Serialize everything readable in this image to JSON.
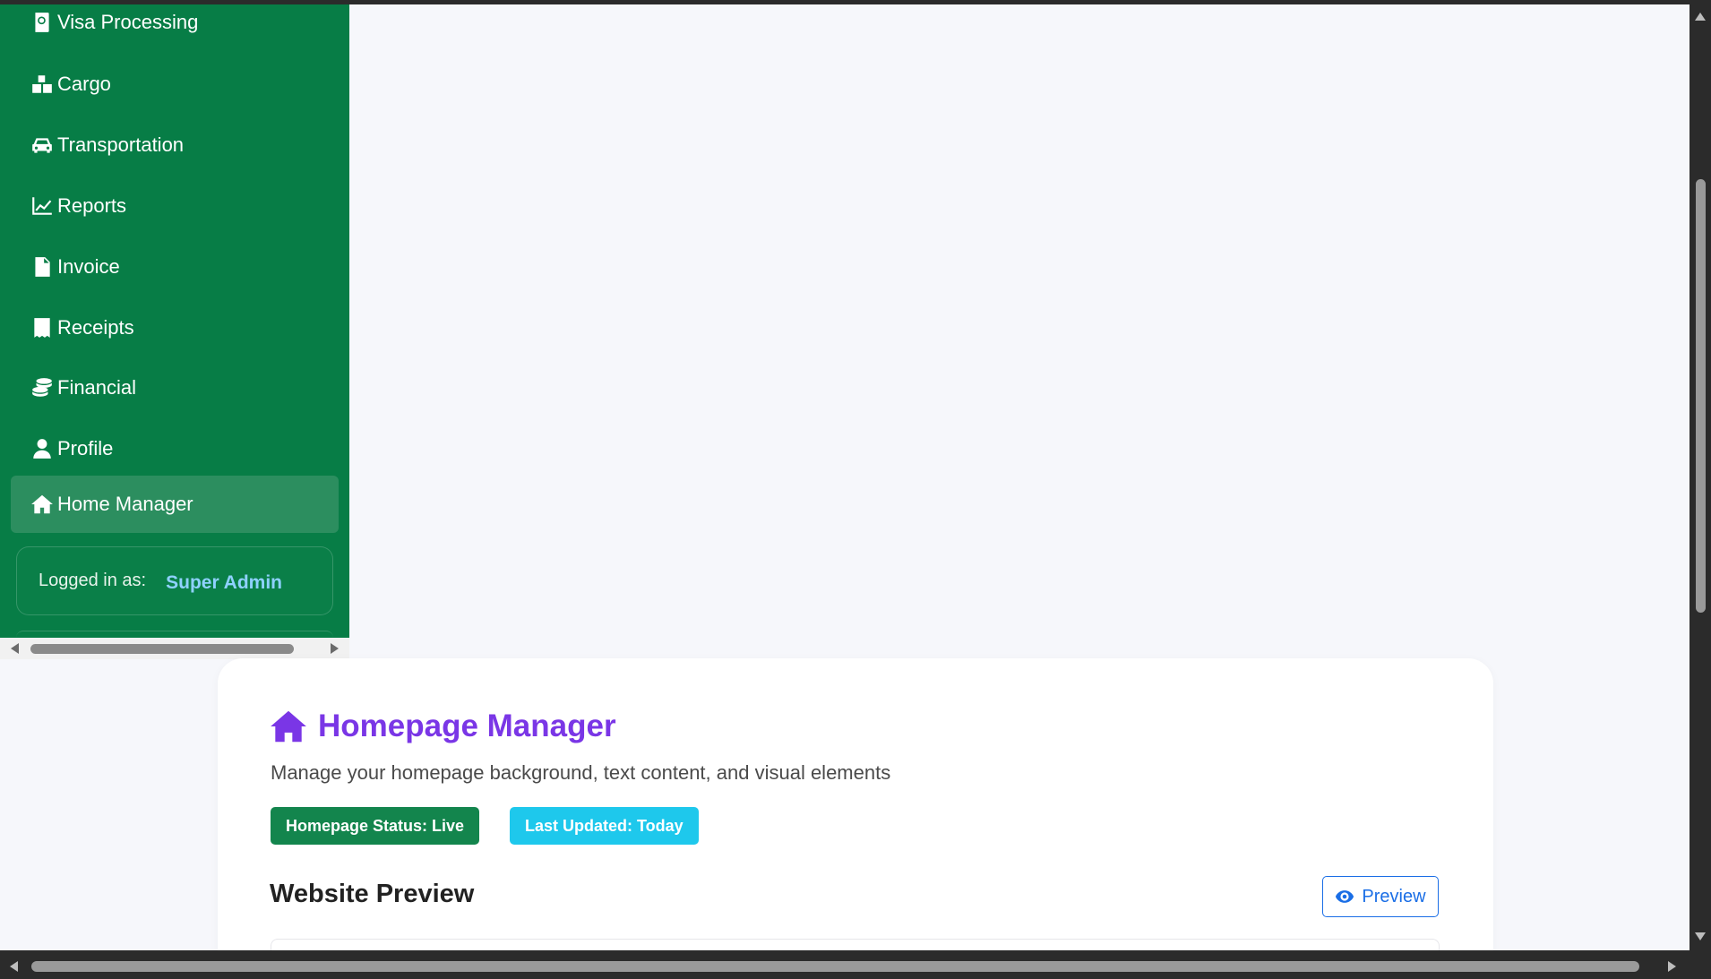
{
  "sidebar": {
    "items": [
      {
        "label": "Visa Processing",
        "icon": "passport-icon"
      },
      {
        "label": "Cargo",
        "icon": "boxes-icon"
      },
      {
        "label": "Transportation",
        "icon": "car-icon"
      },
      {
        "label": "Reports",
        "icon": "chart-line-icon"
      },
      {
        "label": "Invoice",
        "icon": "file-invoice-icon"
      },
      {
        "label": "Receipts",
        "icon": "receipt-icon"
      },
      {
        "label": "Financial",
        "icon": "coins-icon"
      },
      {
        "label": "Profile",
        "icon": "user-icon"
      },
      {
        "label": "Home Manager",
        "icon": "home-icon",
        "active": true
      }
    ],
    "logged_in_label": "Logged in as:",
    "logged_in_user": "Super Admin"
  },
  "main": {
    "title": "Homepage Manager",
    "subtitle": "Manage your homepage background, text content, and visual elements",
    "badges": {
      "status": "Homepage Status: Live",
      "updated": "Last Updated: Today"
    },
    "section_title": "Website Preview",
    "preview_button": "Preview"
  },
  "colors": {
    "sidebar_bg": "#077d46",
    "active_item_bg": "#2c8e5f",
    "title_purple": "#7a36e6",
    "status_badge": "#13854d",
    "updated_badge": "#1ec8ec",
    "preview_blue": "#1a6ee6",
    "logged_user": "#8fd1ff"
  }
}
